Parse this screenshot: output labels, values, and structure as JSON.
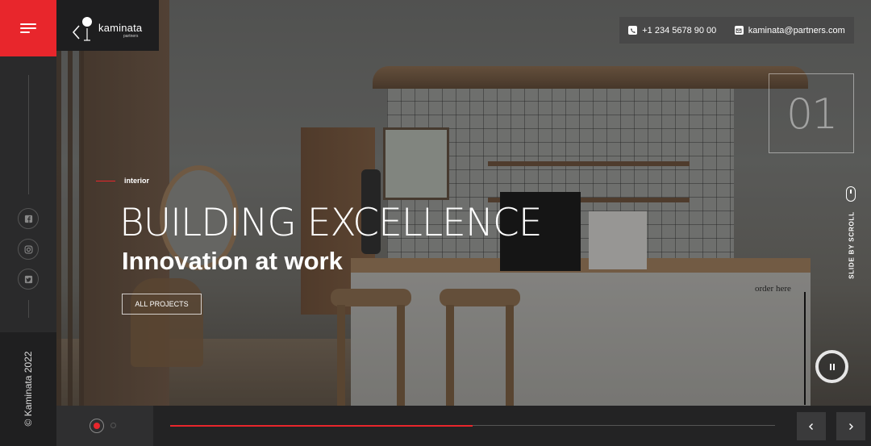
{
  "brand": {
    "logo_text": "kaminata",
    "logo_sub": "partners",
    "copyright": "© Kaminata 2022",
    "accent": "#e8262c"
  },
  "header": {
    "menu_icon": "hamburger-icon",
    "phone": "+1 234 5678 90 00",
    "phone_icon": "phone-icon",
    "email": "kaminata@partners.com",
    "email_icon": "mail-icon"
  },
  "social": [
    {
      "icon": "facebook-icon"
    },
    {
      "icon": "instagram-icon"
    },
    {
      "icon": "twitter-icon"
    }
  ],
  "slide": {
    "number": "01",
    "category": "interior",
    "headline": "BUILDING EXCELLENCE",
    "subheadline": "Innovation at work",
    "cta_label": "ALL PROJECTS",
    "scene_sign": "order here"
  },
  "scroll": {
    "label": "SLIDE BY SCROLL",
    "icon": "mouse-icon"
  },
  "controls": {
    "pause_icon": "pause-icon",
    "prev_icon": "chevron-left-icon",
    "next_icon": "chevron-right-icon",
    "slide_count": 2,
    "active_slide": 1,
    "progress": 0.5
  }
}
